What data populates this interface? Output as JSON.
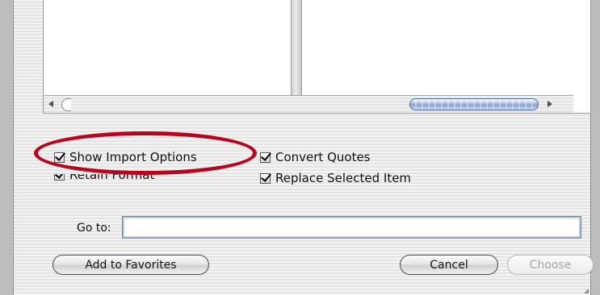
{
  "browser": {
    "columns": [],
    "scroll_left_icon": "left-arrow-icon",
    "scroll_right_icon": "right-arrow-icon"
  },
  "options": {
    "show_import_options": {
      "label": "Show Import Options",
      "checked": true
    },
    "retain_format": {
      "label": "Retain Format",
      "checked": true
    },
    "convert_quotes": {
      "label": "Convert Quotes",
      "checked": true
    },
    "replace_selected_item": {
      "label": "Replace Selected Item",
      "checked": true
    }
  },
  "goto": {
    "label": "Go to:",
    "value": ""
  },
  "buttons": {
    "add_to_favorites": "Add to Favorites",
    "cancel": "Cancel",
    "choose": "Choose"
  },
  "colors": {
    "highlight_ellipse": "#b7051f",
    "scroll_thumb": "#8aa3cf",
    "focus_ring": "#b6cdea"
  }
}
